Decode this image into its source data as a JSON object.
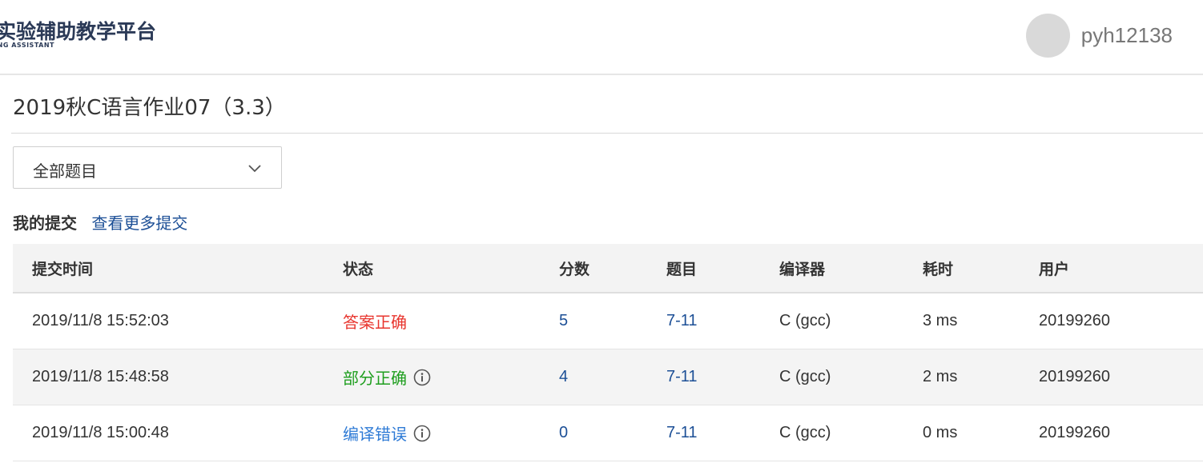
{
  "header": {
    "logo_title": "类实验辅助教学平台",
    "logo_subtitle": "HING ASSISTANT",
    "username": "pyh12138"
  },
  "page": {
    "title": "2019秋C语言作业07（3.3）"
  },
  "filter": {
    "selected": "全部题目"
  },
  "submissions": {
    "label": "我的提交",
    "more_link": "查看更多提交",
    "columns": [
      "提交时间",
      "状态",
      "分数",
      "题目",
      "编译器",
      "耗时",
      "用户"
    ],
    "rows": [
      {
        "time": "2019/11/8 15:52:03",
        "status": "答案正确",
        "status_color": "#e8352e",
        "score": "5",
        "problem": "7-11",
        "compiler": "C (gcc)",
        "duration": "3 ms",
        "user": "20199260"
      },
      {
        "time": "2019/11/8 15:48:58",
        "status": "部分正确",
        "status_color": "#1e9e1e",
        "score": "4",
        "problem": "7-11",
        "compiler": "C (gcc)",
        "duration": "2 ms",
        "user": "20199260"
      },
      {
        "time": "2019/11/8 15:00:48",
        "status": "编译错误",
        "status_color": "#2f7bd6",
        "score": "0",
        "problem": "7-11",
        "compiler": "C (gcc)",
        "duration": "0 ms",
        "user": "20199260"
      }
    ]
  }
}
